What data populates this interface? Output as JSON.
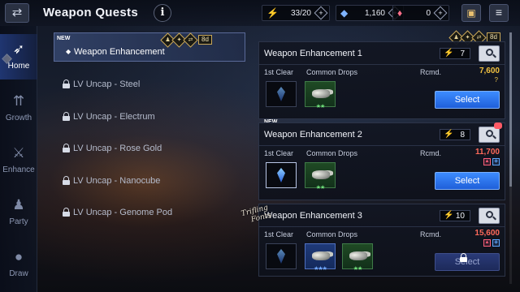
{
  "header": {
    "back_icon": "arrow-left-right-icon",
    "title": "Weapon Quests",
    "info_label": "i",
    "resources": {
      "stamina": {
        "icon": "lightning-icon",
        "value": "33/20"
      },
      "crystals": {
        "icon": "crystal-icon",
        "value": "1,160"
      },
      "gems": {
        "icon": "gem-icon",
        "value": "0"
      }
    },
    "plus_label": "+",
    "box_icon": "briefcase-icon",
    "menu_icon": "hamburger-icon"
  },
  "sidenav": {
    "items": [
      {
        "label": "Home",
        "icon": "bird-icon",
        "active": true
      },
      {
        "label": "Growth",
        "icon": "growth-icon",
        "active": false
      },
      {
        "label": "Enhance",
        "icon": "enhance-icon",
        "active": false
      },
      {
        "label": "Party",
        "icon": "party-icon",
        "active": false
      },
      {
        "label": "Draw",
        "icon": "draw-icon",
        "active": false
      }
    ]
  },
  "quest_list": {
    "badge_days": "8d",
    "items": [
      {
        "label": "Weapon Enhancement",
        "new": "NEW",
        "locked": false,
        "active": true
      },
      {
        "label": "LV Uncap - Steel",
        "locked": true
      },
      {
        "label": "LV Uncap - Electrum",
        "locked": true
      },
      {
        "label": "LV Uncap - Rose Gold",
        "locked": true
      },
      {
        "label": "LV Uncap - Nanocube",
        "locked": true
      },
      {
        "label": "LV Uncap - Genome Pod",
        "locked": true
      }
    ]
  },
  "stages": {
    "col_first": "1st Clear",
    "col_common": "Common Drops",
    "col_rcmd": "Rcmd.",
    "select_label": "Select",
    "badge_days": "8d",
    "items": [
      {
        "name": "Weapon Enhancement 1",
        "cost": "7",
        "rcmd": "7,600",
        "rcmd_sub": "?",
        "rcmd_color": "#f0c040",
        "new": "",
        "elements": []
      },
      {
        "name": "Weapon Enhancement 2",
        "cost": "8",
        "rcmd": "11,700",
        "rcmd_color": "#ff6a5a",
        "new": "NEW",
        "elements": [
          "fire",
          "wind"
        ]
      },
      {
        "name": "Weapon Enhancement 3",
        "cost": "10",
        "rcmd": "15,600",
        "rcmd_color": "#ff6a5a",
        "new": "",
        "elements": [
          "fire",
          "wind"
        ],
        "locked": true
      }
    ]
  },
  "watermark": {
    "line1": "Trifling",
    "line2": "Fonts"
  }
}
